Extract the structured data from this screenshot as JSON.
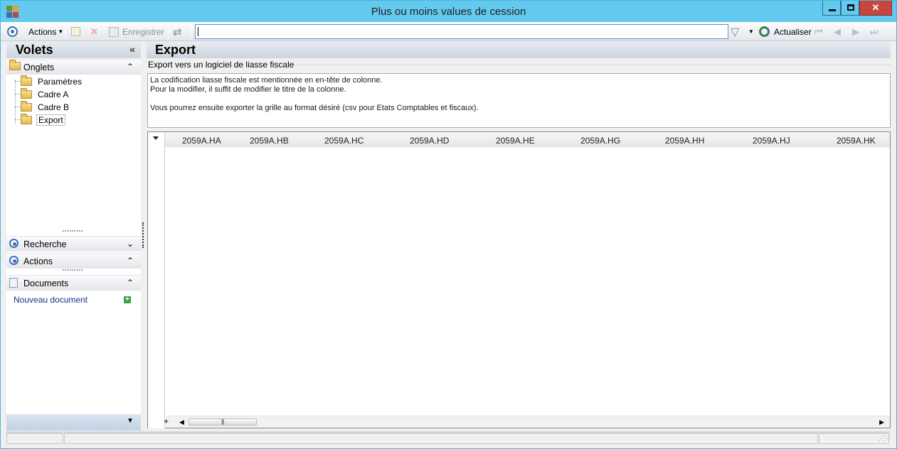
{
  "window": {
    "title": "Plus ou moins values de cession",
    "close_glyph": "✕"
  },
  "toolbar": {
    "actions_label": "Actions",
    "save_label": "Enregistrer",
    "search_value": "",
    "refresh_label": "Actualiser"
  },
  "left_panel": {
    "title": "Volets",
    "collapse_glyph": "«",
    "sections": {
      "onglets": {
        "label": "Onglets",
        "chevron": "⌃"
      },
      "recherche": {
        "label": "Recherche",
        "chevron": "⌄"
      },
      "actions": {
        "label": "Actions",
        "chevron": "⌃"
      },
      "documents": {
        "label": "Documents",
        "chevron": "⌃"
      }
    },
    "tree_items": [
      "Paramètres",
      "Cadre A",
      "Cadre B",
      "Export"
    ],
    "selected_tree_item": "Export",
    "documents_link": "Nouveau document"
  },
  "main": {
    "title": "Export",
    "group_label": "Export vers un logiciel de liasse fiscale",
    "description_lines": [
      "La codification liasse fiscale est mentionnée en en-tête de colonne.",
      "Pour la modifier, il suffit de modifier le titre de la colonne.",
      "",
      "Vous pourrez ensuite exporter la grille au format désiré (csv pour Etats Comptables et fiscaux)."
    ],
    "grid_columns": [
      "2059A.HA",
      "2059A.HB",
      "2059A.HC",
      "2059A.HD",
      "2059A.HE",
      "2059A.HG",
      "2059A.HH",
      "2059A.HJ",
      "2059A.HK"
    ]
  },
  "colors": {
    "titlebar": "#63c9ee",
    "close_button": "#c7463d",
    "accent_blue": "#3b6db5",
    "link": "#1a2f8a"
  }
}
